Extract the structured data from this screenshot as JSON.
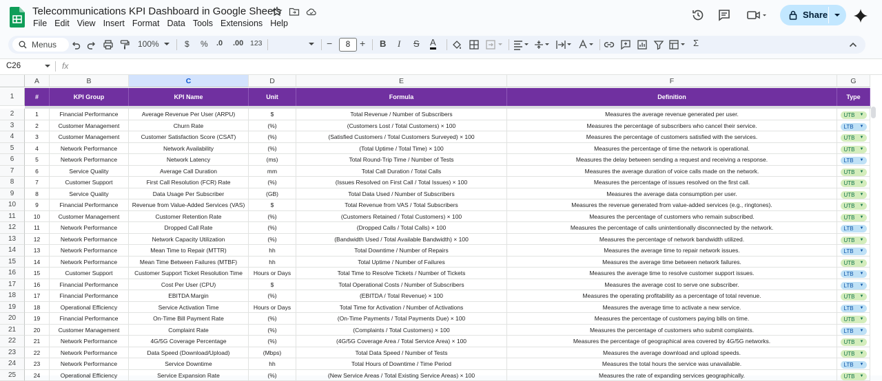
{
  "app": {
    "title": "Telecommunications KPI Dashboard in Google Sheets",
    "menus": [
      "File",
      "Edit",
      "View",
      "Insert",
      "Format",
      "Data",
      "Tools",
      "Extensions",
      "Help"
    ],
    "share_label": "Share",
    "accent": "#7030a0"
  },
  "toolbar": {
    "search_label": "Menus",
    "zoom": "100%",
    "currency": "$",
    "percent": "%",
    "dec_decrease": ".0",
    "dec_increase": ".00",
    "number_format": "123",
    "font_size": "8",
    "minus": "−",
    "plus": "+",
    "bold": "B",
    "italic": "I",
    "strike": "S",
    "text_color": "A",
    "sum": "Σ"
  },
  "formula_bar": {
    "cell_ref": "C26",
    "fx": "fx"
  },
  "columns": [
    {
      "letter": "A",
      "header": "#"
    },
    {
      "letter": "B",
      "header": "KPI Group"
    },
    {
      "letter": "C",
      "header": "KPI Name"
    },
    {
      "letter": "D",
      "header": "Unit"
    },
    {
      "letter": "E",
      "header": "Formula"
    },
    {
      "letter": "F",
      "header": "Definition"
    },
    {
      "letter": "G",
      "header": "Type"
    }
  ],
  "rows": [
    {
      "row": "2",
      "n": "1",
      "group": "Financial Performance",
      "name": "Average Revenue Per User (ARPU)",
      "unit": "$",
      "formula": "Total Revenue / Number of Subscribers",
      "definition": "Measures the average revenue generated per user.",
      "type": "UTB"
    },
    {
      "row": "3",
      "n": "2",
      "group": "Customer Management",
      "name": "Churn Rate",
      "unit": "(%)",
      "formula": "(Customers Lost / Total Customers) × 100",
      "definition": "Measures the percentage of subscribers who cancel their service.",
      "type": "LTB"
    },
    {
      "row": "4",
      "n": "3",
      "group": "Customer Management",
      "name": "Customer Satisfaction Score (CSAT)",
      "unit": "(%)",
      "formula": "(Satisfied Customers / Total Customers Surveyed) × 100",
      "definition": "Measures the percentage of customers satisfied with the services.",
      "type": "UTB"
    },
    {
      "row": "5",
      "n": "4",
      "group": "Network Performance",
      "name": "Network Availability",
      "unit": "(%)",
      "formula": "(Total Uptime / Total Time) × 100",
      "definition": "Measures the percentage of time the network is operational.",
      "type": "UTB"
    },
    {
      "row": "6",
      "n": "5",
      "group": "Network Performance",
      "name": "Network Latency",
      "unit": "(ms)",
      "formula": "Total Round-Trip Time / Number of Tests",
      "definition": "Measures the delay between sending a request and receiving a response.",
      "type": "LTB"
    },
    {
      "row": "7",
      "n": "6",
      "group": "Service Quality",
      "name": "Average Call Duration",
      "unit": "mm",
      "formula": "Total Call Duration / Total Calls",
      "definition": "Measures the average duration of voice calls made on the network.",
      "type": "UTB"
    },
    {
      "row": "8",
      "n": "7",
      "group": "Customer Support",
      "name": "First Call Resolution (FCR) Rate",
      "unit": "(%)",
      "formula": "(Issues Resolved on First Call / Total Issues) × 100",
      "definition": "Measures the percentage of issues resolved on the first call.",
      "type": "UTB"
    },
    {
      "row": "9",
      "n": "8",
      "group": "Service Quality",
      "name": "Data Usage Per Subscriber",
      "unit": "(GB)",
      "formula": "Total Data Used / Number of Subscribers",
      "definition": "Measures the average data consumption per user.",
      "type": "UTB"
    },
    {
      "row": "10",
      "n": "9",
      "group": "Financial Performance",
      "name": "Revenue from Value-Added Services (VAS)",
      "unit": "$",
      "formula": "Total Revenue from VAS / Total Subscribers",
      "definition": "Measures the revenue generated from value-added services (e.g., ringtones).",
      "type": "UTB"
    },
    {
      "row": "11",
      "n": "10",
      "group": "Customer Management",
      "name": "Customer Retention Rate",
      "unit": "(%)",
      "formula": "(Customers Retained / Total Customers) × 100",
      "definition": "Measures the percentage of customers who remain subscribed.",
      "type": "UTB"
    },
    {
      "row": "12",
      "n": "11",
      "group": "Network Performance",
      "name": "Dropped Call Rate",
      "unit": "(%)",
      "formula": "(Dropped Calls / Total Calls) × 100",
      "definition": "Measures the percentage of calls unintentionally disconnected by the network.",
      "type": "LTB"
    },
    {
      "row": "13",
      "n": "12",
      "group": "Network Performance",
      "name": "Network Capacity Utilization",
      "unit": "(%)",
      "formula": "(Bandwidth Used / Total Available Bandwidth) × 100",
      "definition": "Measures the percentage of network bandwidth utilized.",
      "type": "UTB"
    },
    {
      "row": "14",
      "n": "13",
      "group": "Network Performance",
      "name": "Mean Time to Repair (MTTR)",
      "unit": "hh",
      "formula": "Total Downtime / Number of Repairs",
      "definition": "Measures the average time to repair network issues.",
      "type": "LTB"
    },
    {
      "row": "15",
      "n": "14",
      "group": "Network Performance",
      "name": "Mean Time Between Failures (MTBF)",
      "unit": "hh",
      "formula": "Total Uptime / Number of Failures",
      "definition": "Measures the average time between network failures.",
      "type": "UTB"
    },
    {
      "row": "16",
      "n": "15",
      "group": "Customer Support",
      "name": "Customer Support Ticket Resolution Time",
      "unit": "Hours or Days",
      "formula": "Total Time to Resolve Tickets / Number of Tickets",
      "definition": "Measures the average time to resolve customer support issues.",
      "type": "LTB"
    },
    {
      "row": "17",
      "n": "16",
      "group": "Financial Performance",
      "name": "Cost Per User (CPU)",
      "unit": "$",
      "formula": "Total Operational Costs / Number of Subscribers",
      "definition": "Measures the average cost to serve one subscriber.",
      "type": "LTB"
    },
    {
      "row": "18",
      "n": "17",
      "group": "Financial Performance",
      "name": "EBITDA Margin",
      "unit": "(%)",
      "formula": "(EBITDA / Total Revenue) × 100",
      "definition": "Measures the operating profitability as a percentage of total revenue.",
      "type": "UTB"
    },
    {
      "row": "19",
      "n": "18",
      "group": "Operational Efficiency",
      "name": "Service Activation Time",
      "unit": "Hours or Days",
      "formula": "Total Time for Activation / Number of Activations",
      "definition": "Measures the average time to activate a new service.",
      "type": "LTB"
    },
    {
      "row": "20",
      "n": "19",
      "group": "Financial Performance",
      "name": "On-Time Bill Payment Rate",
      "unit": "(%)",
      "formula": "(On-Time Payments / Total Payments Due) × 100",
      "definition": "Measures the percentage of customers paying bills on time.",
      "type": "UTB"
    },
    {
      "row": "21",
      "n": "20",
      "group": "Customer Management",
      "name": "Complaint Rate",
      "unit": "(%)",
      "formula": "(Complaints / Total Customers) × 100",
      "definition": "Measures the percentage of customers who submit complaints.",
      "type": "LTB"
    },
    {
      "row": "22",
      "n": "21",
      "group": "Network Performance",
      "name": "4G/5G Coverage Percentage",
      "unit": "(%)",
      "formula": "(4G/5G Coverage Area / Total Service Area) × 100",
      "definition": "Measures the percentage of geographical area covered by 4G/5G networks.",
      "type": "UTB"
    },
    {
      "row": "23",
      "n": "22",
      "group": "Network Performance",
      "name": "Data Speed (Download/Upload)",
      "unit": "(Mbps)",
      "formula": "Total Data Speed / Number of Tests",
      "definition": "Measures the average download and upload speeds.",
      "type": "UTB"
    },
    {
      "row": "24",
      "n": "23",
      "group": "Network Performance",
      "name": "Service Downtime",
      "unit": "hh",
      "formula": "Total Hours of Downtime / Time Period",
      "definition": "Measures the total hours the service was unavailable.",
      "type": "LTB"
    },
    {
      "row": "25",
      "n": "24",
      "group": "Operational Efficiency",
      "name": "Service Expansion Rate",
      "unit": "(%)",
      "formula": "(New Service Areas / Total Existing Service Areas) × 100",
      "definition": "Measures the rate of expanding services geographically.",
      "type": "UTB"
    }
  ],
  "chip_colors": {
    "UTB": {
      "bg": "#d4edbc",
      "fg": "#11734b"
    },
    "LTB": {
      "bg": "#bfe1f6",
      "fg": "#0a53a8"
    }
  }
}
